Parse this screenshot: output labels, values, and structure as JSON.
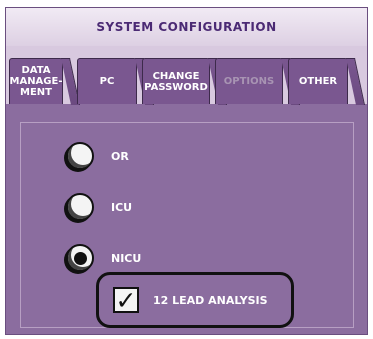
{
  "title": "SYSTEM CONFIGURATION",
  "tabs": [
    {
      "label": "DATA\nMANAGE-\nMENT",
      "enabled": true
    },
    {
      "label": "PC",
      "enabled": true
    },
    {
      "label": "CHANGE\nPASSWORD",
      "enabled": true
    },
    {
      "label": "OPTIONS",
      "enabled": false
    },
    {
      "label": "OTHER",
      "enabled": true
    }
  ],
  "radio_options": [
    {
      "label": "OR",
      "selected": false
    },
    {
      "label": "ICU",
      "selected": false
    },
    {
      "label": "NICU",
      "selected": true
    }
  ],
  "checkbox": {
    "label": "12 LEAD ANALYSIS",
    "checked": true,
    "check_glyph": "✓"
  },
  "colors": {
    "panel": "#8b6d9f",
    "tab": "#7a5790",
    "title_text": "#4b2a74",
    "tab_bar": "#d8c9df"
  }
}
